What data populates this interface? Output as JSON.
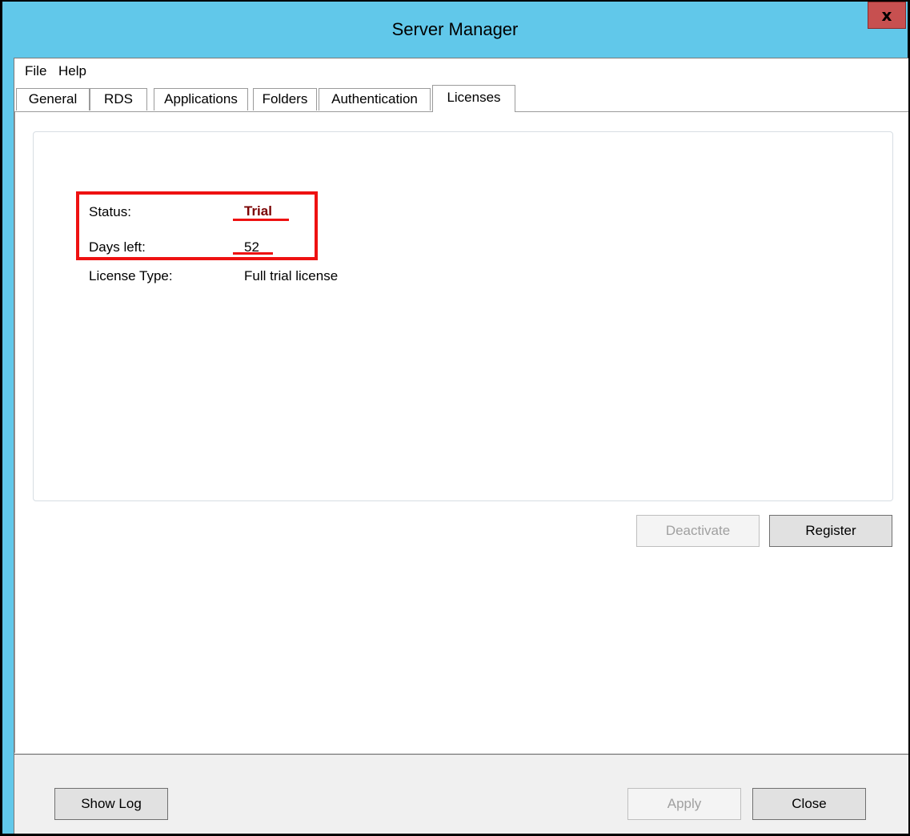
{
  "window": {
    "title": "Server Manager",
    "close_glyph": "x"
  },
  "menu": {
    "items": [
      "File",
      "Help"
    ]
  },
  "tabs": [
    {
      "label": "General",
      "active": false
    },
    {
      "label": "RDS",
      "active": false
    },
    {
      "label": "Applications",
      "active": false
    },
    {
      "label": "Folders",
      "active": false
    },
    {
      "label": "Authentication",
      "active": false
    },
    {
      "label": "Licenses",
      "active": true
    }
  ],
  "license": {
    "status_label": "Status:",
    "status_value": "Trial",
    "days_label": "Days left:",
    "days_value": "52",
    "type_label": "License Type:",
    "type_value": "Full trial license"
  },
  "buttons": {
    "deactivate": "Deactivate",
    "register": "Register",
    "show_log": "Show Log",
    "apply": "Apply",
    "close": "Close"
  },
  "colors": {
    "titlebar": "#61c8ea",
    "close_button": "#c75050",
    "status_text": "#7a0000",
    "annotation": "#ee1111"
  }
}
